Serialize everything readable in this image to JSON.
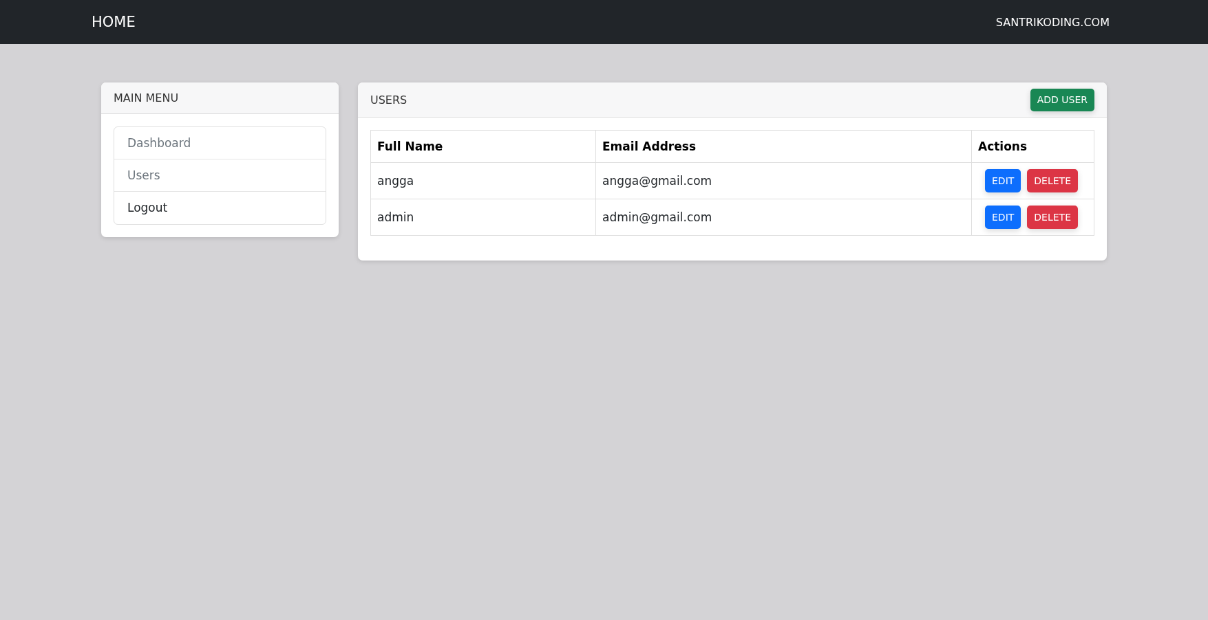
{
  "navbar": {
    "brand": "HOME",
    "link": "SANTRIKODING.COM"
  },
  "sidebar": {
    "title": "MAIN MENU",
    "items": [
      {
        "label": "Dashboard",
        "muted": true
      },
      {
        "label": "Users",
        "muted": true
      },
      {
        "label": "Logout",
        "muted": false
      }
    ]
  },
  "users_card": {
    "title": "USERS",
    "add_button": "ADD USER",
    "table": {
      "columns": [
        "Full Name",
        "Email Address",
        "Actions"
      ],
      "rows": [
        {
          "full_name": "angga",
          "email": "angga@gmail.com",
          "actions": [
            {
              "label": "EDIT",
              "kind": "edit"
            },
            {
              "label": "DELETE",
              "kind": "delete"
            }
          ]
        },
        {
          "full_name": "admin",
          "email": "admin@gmail.com",
          "actions": [
            {
              "label": "EDIT",
              "kind": "edit"
            },
            {
              "label": "DELETE",
              "kind": "delete"
            }
          ]
        }
      ]
    }
  }
}
